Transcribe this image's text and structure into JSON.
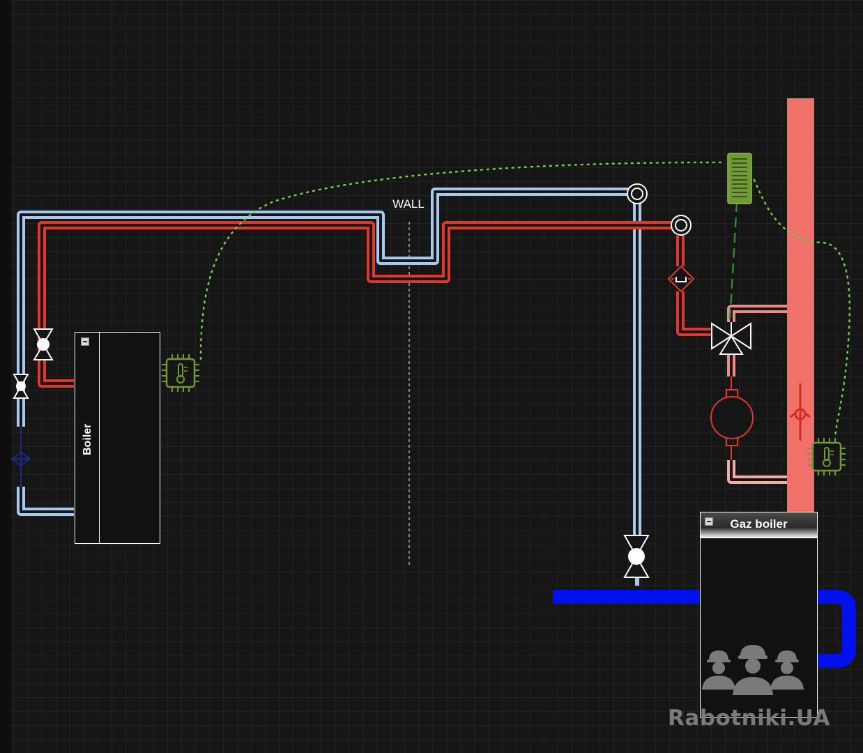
{
  "diagram": {
    "wall_label": "WALL",
    "boiler_label": "Boiler",
    "gaz_boiler_label": "Gaz boiler",
    "watermark": "Rabotniki.UA"
  },
  "colors": {
    "background": "#161616",
    "cold_pipe": "#a9c8f0",
    "hot_pipe": "#e0392b",
    "heating_pipe": "#f0706a",
    "water_supply": "#0011ee",
    "sensor": "#6f9a36",
    "wire": "#6fcf4a"
  },
  "icons": [
    "ball-valve-icon",
    "check-valve-icon",
    "filter-icon",
    "three-way-valve-icon",
    "pump-icon",
    "temperature-sensor-icon",
    "thermostat-icon",
    "elbow-icon",
    "workers-logo-icon"
  ]
}
